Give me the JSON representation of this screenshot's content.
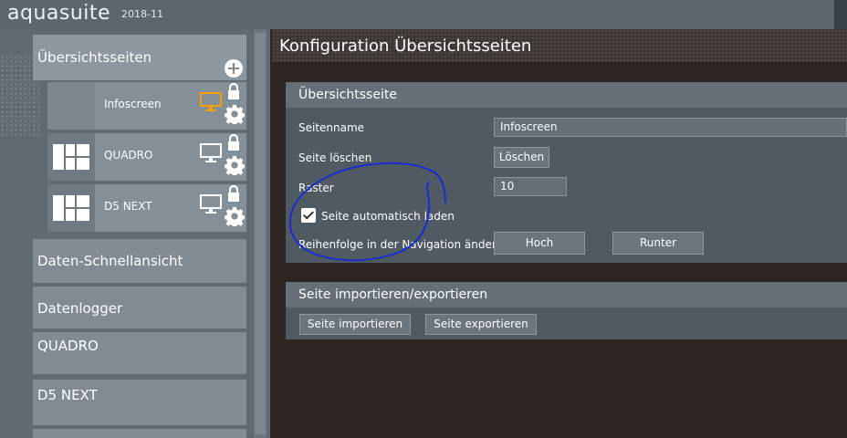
{
  "app": {
    "name": "aquasuite",
    "version": "2018-11"
  },
  "sidebar": {
    "overview": {
      "label": "Übersichtsseiten"
    },
    "pages": [
      {
        "label": "Infoscreen",
        "monitor_color": "#f0a000"
      },
      {
        "label": "QUADRO",
        "monitor_color": "#ffffff"
      },
      {
        "label": "D5 NEXT",
        "monitor_color": "#ffffff"
      }
    ],
    "items": [
      {
        "label": "Daten-Schnellansicht"
      },
      {
        "label": "Datenlogger"
      },
      {
        "label": "QUADRO"
      },
      {
        "label": "D5 NEXT"
      }
    ]
  },
  "main": {
    "title": "Konfiguration Übersichtsseiten",
    "overview_section": {
      "title": "Übersichtsseite",
      "page_name_label": "Seitenname",
      "page_name_value": "Infoscreen",
      "delete_label": "Seite löschen",
      "delete_button": "Löschen",
      "grid_label": "Raster",
      "grid_value": "10",
      "autoload_label": "Seite automatisch laden",
      "autoload_checked": true,
      "order_label": "Reihenfolge in der Navigation ändern",
      "up_button": "Hoch",
      "down_button": "Runter"
    },
    "import_section": {
      "title": "Seite importieren/exportieren",
      "import_button": "Seite importieren",
      "export_button": "Seite exportieren"
    }
  },
  "colors": {
    "accent": "#f0a000",
    "annotation": "#1a2bd0"
  }
}
